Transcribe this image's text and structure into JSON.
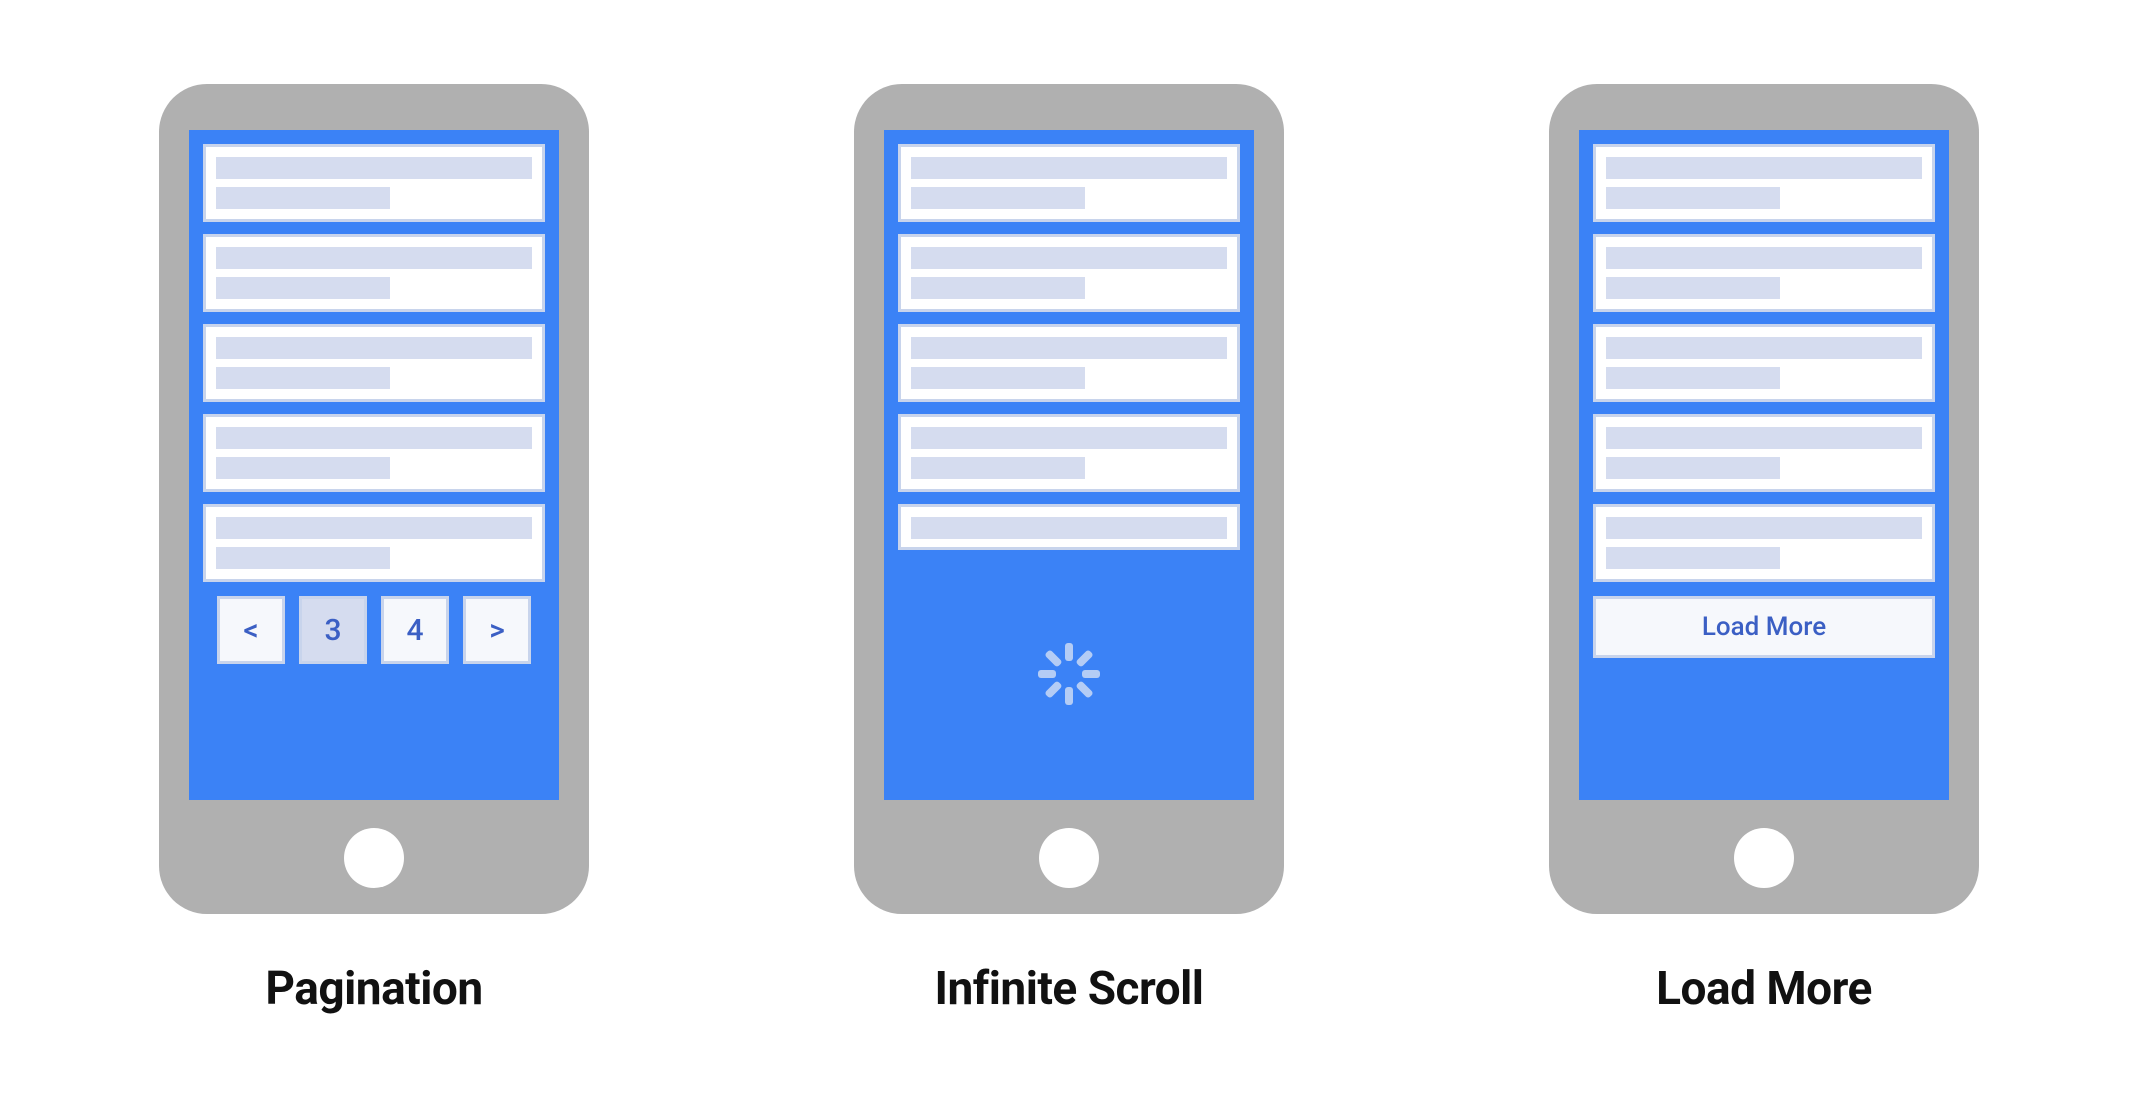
{
  "captions": {
    "pagination": "Pagination",
    "infinite": "Infinite Scroll",
    "loadmore": "Load More"
  },
  "pager": {
    "prev": "<",
    "p3": "3",
    "p4": "4",
    "next": ">"
  },
  "loadmore_button": "Load More"
}
